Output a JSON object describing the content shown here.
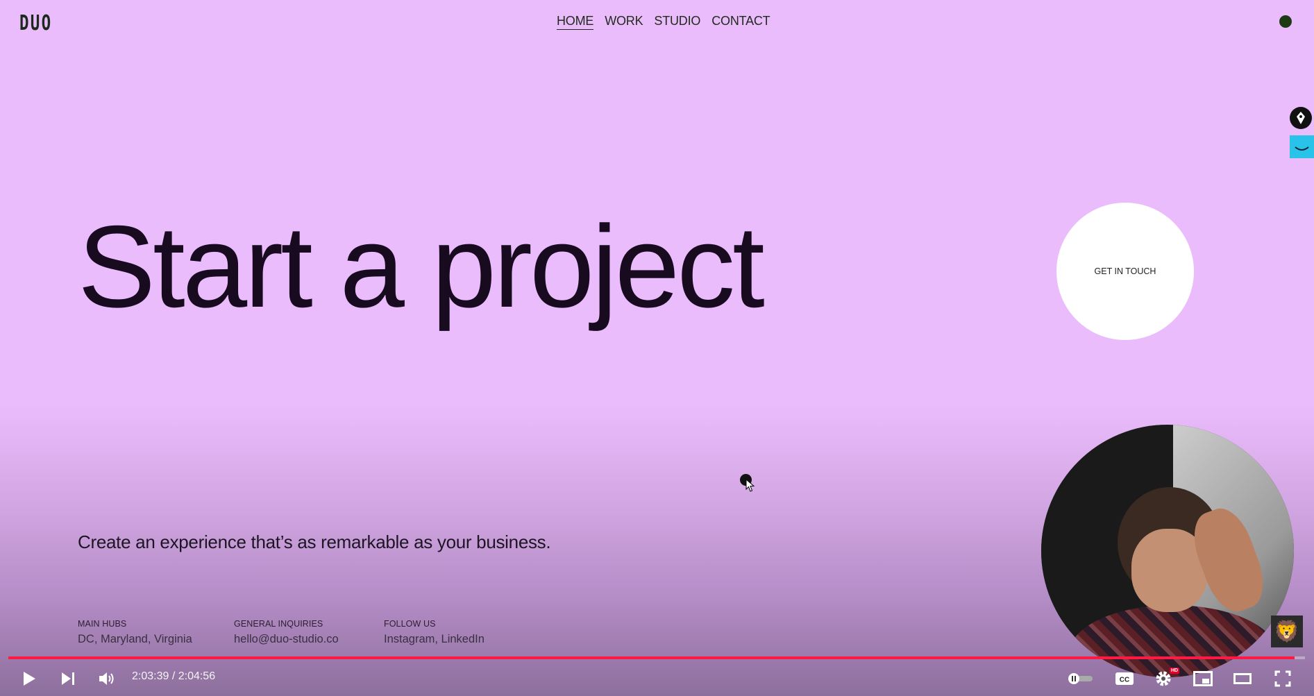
{
  "site": {
    "logo": "DUO",
    "nav": [
      {
        "label": "HOME",
        "active": true
      },
      {
        "label": "WORK",
        "active": false
      },
      {
        "label": "STUDIO",
        "active": false
      },
      {
        "label": "CONTACT",
        "active": false
      }
    ],
    "headline": "Start a project",
    "cta_label": "GET IN TOUCH",
    "tagline": "Create an experience that’s as remarkable as your business.",
    "info": [
      {
        "label": "MAIN HUBS",
        "value": "DC, Maryland, Virginia"
      },
      {
        "label": "GENERAL INQUIRIES",
        "value": "hello@duo-studio.co"
      },
      {
        "label": "FOLLOW US",
        "value": "Instagram, LinkedIn"
      }
    ],
    "colors": {
      "background": "#ebbcfc",
      "text": "#190b1f",
      "accent_dot": "#1d3a14"
    }
  },
  "player": {
    "time": "2:03:39 / 2:04:56",
    "progress_fraction": 0.992,
    "hd_badge": "HD",
    "progress_color": "#ff1a45",
    "controls": [
      "play-icon",
      "next-icon",
      "volume-icon",
      "autoplay-toggle",
      "captions-icon",
      "settings-icon",
      "miniplayer-icon",
      "theater-icon",
      "fullscreen-icon"
    ]
  }
}
